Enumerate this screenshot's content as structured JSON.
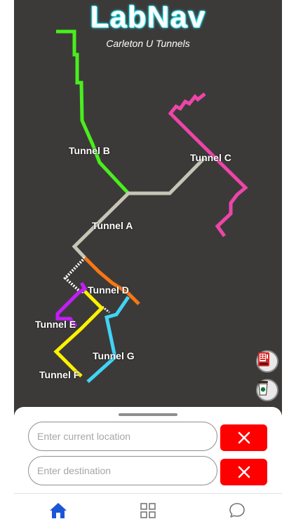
{
  "header": {
    "title": "LabNav",
    "subtitle": "Carleton U Tunnels"
  },
  "map": {
    "tunnels": [
      {
        "name": "Tunnel A",
        "color": "#c7c5b6"
      },
      {
        "name": "Tunnel B",
        "color": "#49ef1c"
      },
      {
        "name": "Tunnel C",
        "color": "#ee45a9"
      },
      {
        "name": "Tunnel D",
        "color": "#f77714"
      },
      {
        "name": "Tunnel E",
        "color": "#c11ef6"
      },
      {
        "name": "Tunnel F",
        "color": "#fff200"
      },
      {
        "name": "Tunnel G",
        "color": "#40d4f6"
      }
    ],
    "poi_buttons": [
      {
        "icon": "vending-machine-icon"
      },
      {
        "icon": "coffee-cup-icon"
      }
    ]
  },
  "search": {
    "current_placeholder": "Enter current location",
    "destination_placeholder": "Enter destination",
    "clear_icon": "close-icon"
  },
  "tabbar": {
    "items": [
      {
        "icon": "home-icon",
        "active": true
      },
      {
        "icon": "grid-icon",
        "active": false
      },
      {
        "icon": "chat-icon",
        "active": false
      }
    ]
  },
  "colors": {
    "accent": "#1a56d6",
    "map_bg": "#3c3a39",
    "clear_button": "#ff0000",
    "title_glow": "#35e6f2"
  }
}
